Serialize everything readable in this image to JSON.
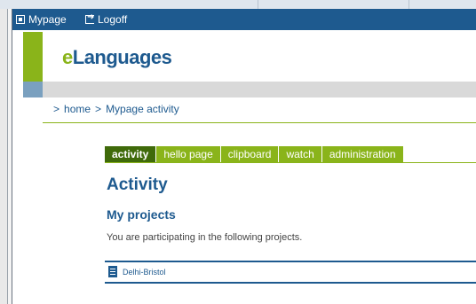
{
  "topbar": {
    "mypage_label": "Mypage",
    "logoff_label": "Logoff"
  },
  "logo": {
    "first": "e",
    "rest": "Languages"
  },
  "breadcrumb": {
    "sep1": ">",
    "home": "home",
    "sep2": ">",
    "current": "Mypage activity"
  },
  "tabs": [
    {
      "label": "activity",
      "active": true
    },
    {
      "label": "hello page"
    },
    {
      "label": "clipboard"
    },
    {
      "label": "watch"
    },
    {
      "label": "administration"
    }
  ],
  "main": {
    "title": "Activity",
    "section_title": "My projects",
    "intro": "You are participating in the following projects.",
    "projects": [
      {
        "label": "Delhi-Bristol"
      }
    ]
  },
  "colors": {
    "brand_blue": "#1e5a8f",
    "brand_green": "#8ab41a",
    "active_tab": "#3f6a0a"
  }
}
